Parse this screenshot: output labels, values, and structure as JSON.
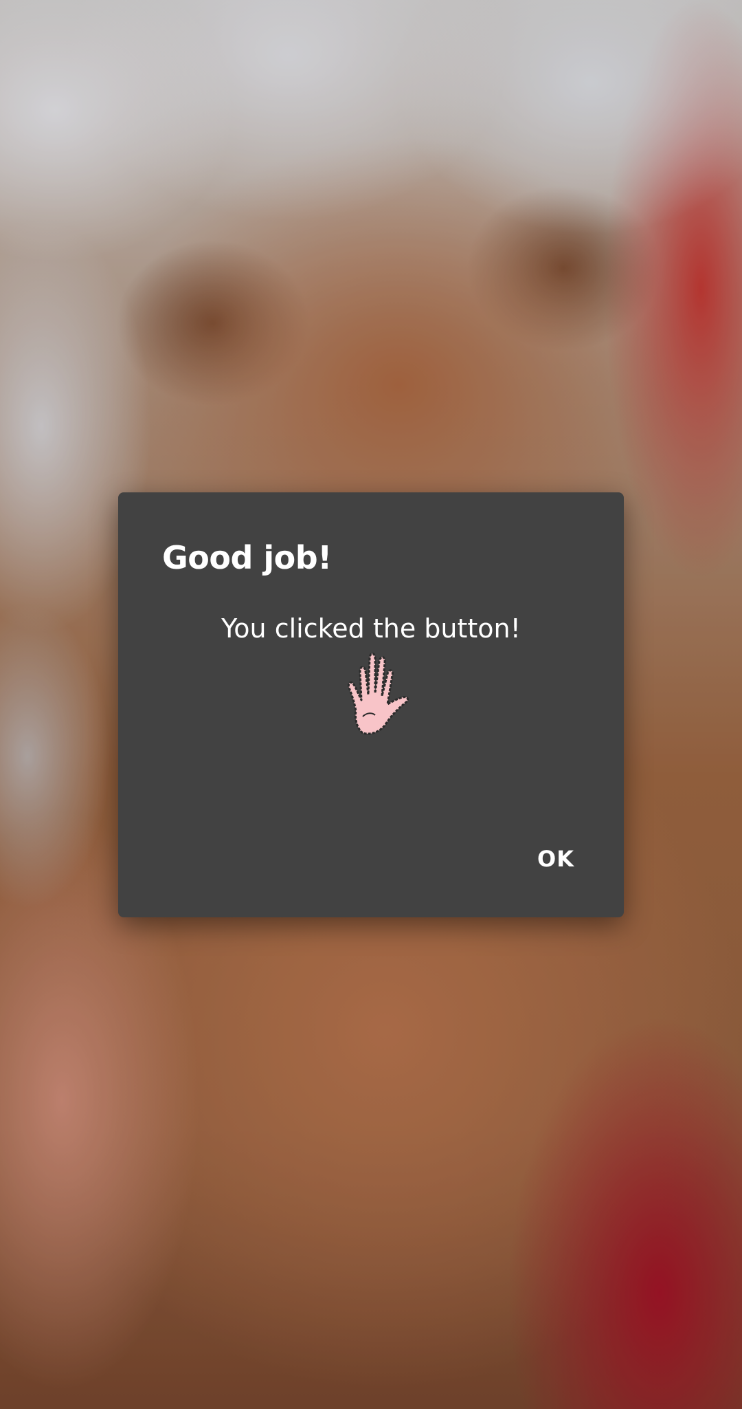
{
  "dialog": {
    "title": "Good job!",
    "message": "You clicked the button!",
    "icon": "waving-hand-icon",
    "ok_label": "OK"
  },
  "colors": {
    "dialog_background": "#424242",
    "text": "#ffffff",
    "hand_fill": "#f8c4c8"
  }
}
